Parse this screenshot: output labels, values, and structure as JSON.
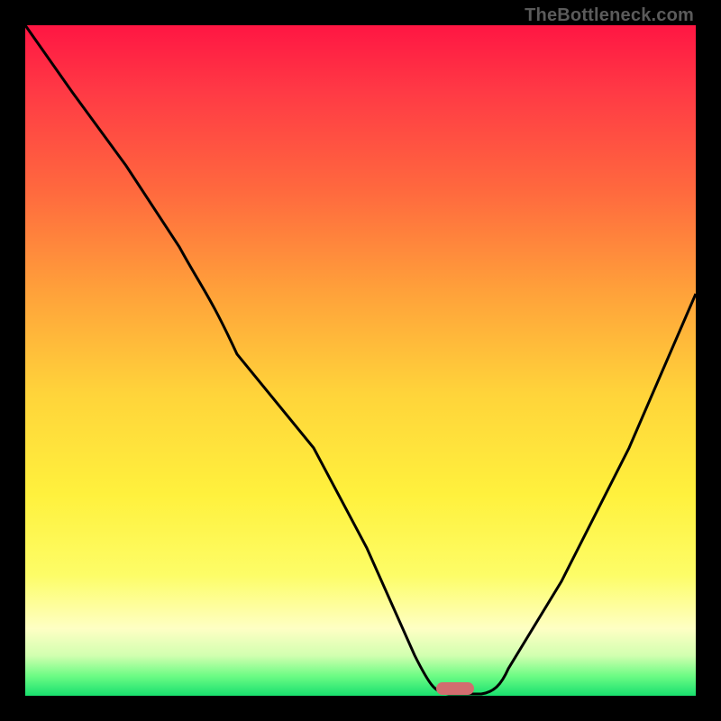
{
  "attribution": "TheBottleneck.com",
  "colors": {
    "frame": "#000000",
    "curve": "#000000",
    "marker": "#d26d6f",
    "gradient_top": "#ff1643",
    "gradient_bottom": "#18e06e"
  },
  "chart_data": {
    "type": "line",
    "title": "",
    "xlabel": "",
    "ylabel": "",
    "xlim": [
      0,
      100
    ],
    "ylim": [
      0,
      100
    ],
    "grid": false,
    "legend": false,
    "note": "Axes have no tick labels; values are read as percentages of plot width/height. y encodes bottleneck mismatch (0 = balanced, shown as green floor).",
    "series": [
      {
        "name": "bottleneck-curve",
        "x": [
          0,
          7,
          15,
          23,
          28,
          35,
          43,
          51,
          58,
          60,
          62,
          65,
          68,
          72,
          80,
          90,
          100
        ],
        "y": [
          100,
          90,
          79,
          67,
          62,
          51,
          37,
          22,
          6,
          2,
          0,
          0,
          0,
          4,
          17,
          37,
          60
        ]
      }
    ],
    "annotations": [
      {
        "name": "optimal-marker",
        "shape": "pill",
        "x": 64,
        "y": 0,
        "width_pct": 5.6,
        "color": "#d26d6f"
      }
    ]
  }
}
